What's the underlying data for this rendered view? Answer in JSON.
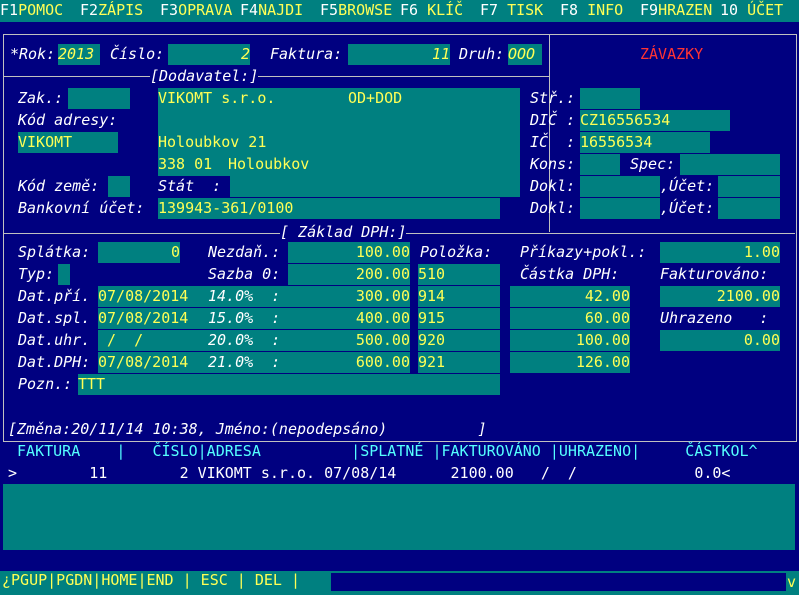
{
  "fkeys": [
    {
      "key": "F1",
      "label": "POMOC"
    },
    {
      "key": "F2",
      "label": "ZÁPIS"
    },
    {
      "key": "F3",
      "label": "OPRAVA"
    },
    {
      "key": "F4",
      "label": "NAJDI"
    },
    {
      "key": "F5",
      "label": "BROWSE"
    },
    {
      "key": "F6",
      "label": " KLÍČ"
    },
    {
      "key": "F7",
      "label": " TISK"
    },
    {
      "key": "F8",
      "label": " INFO"
    },
    {
      "key": "F9",
      "label": "HRAZEN"
    },
    {
      "key": "10",
      "label": " ÚČET"
    }
  ],
  "header": {
    "rok_label": "*Rok:",
    "rok": "2013",
    "cislo_label": "Číslo:",
    "cislo": "2",
    "faktura_label": "Faktura:",
    "faktura": "11",
    "druh_label": "Druh:",
    "druh": "OOO",
    "doc_type": "ZÁVAZKY"
  },
  "dodavatel": {
    "title": "[Dodavatel:]",
    "zak_label": "Zak.:",
    "zak": "",
    "name": "VIKOMT s.r.o.",
    "name_suffix": "OD+DOD",
    "kod_adresy_label": "Kód adresy:",
    "kod_adresy": "VIKOMT",
    "street": "Holoubkov 21",
    "psc": "338 01",
    "city": "Holoubkov",
    "kod_zeme_label": "Kód země:",
    "stat_label": "Stát  :",
    "bank_label": "Bankovní účet:",
    "bank": "139943-361/0100"
  },
  "side": {
    "str_label": "Stř.:",
    "dic_label": "DIČ :",
    "dic": "CZ16556534",
    "ic_label": "IČ  :",
    "ic": "16556534",
    "kons_label": "Kons:",
    "spec_label": "Spec:",
    "dokl_label": "Dokl:",
    "ucet_label": ",Účet:"
  },
  "dph": {
    "title": "[ Základ DPH:]",
    "splatka_label": "Splátka:",
    "splatka": "0",
    "typ_label": "Typ:",
    "dat_pri_label": "Dat.pří.",
    "dat_pri": "07/08/2014",
    "dat_spl_label": "Dat.spl.",
    "dat_spl": "07/08/2014",
    "dat_uhr_label": "Dat.uhr.",
    "dat_uhr": " /  /",
    "dat_dph_label": "Dat.DPH:",
    "dat_dph": "07/08/2014",
    "pozn_label": "Pozn.:",
    "pozn": "TTT",
    "nezdan_label": "Nezdaň.:",
    "sazba0_label": "Sazba 0:",
    "rate_rows": [
      {
        "label": "14.0%  :"
      },
      {
        "label": "15.0%  :"
      },
      {
        "label": "20.0%  :"
      },
      {
        "label": "21.0%  :"
      }
    ],
    "amounts": [
      "100.00",
      "200.00",
      "300.00",
      "400.00",
      "500.00",
      "600.00"
    ],
    "polozka_label": "Položka:",
    "polozky": [
      "",
      "510",
      "914",
      "915",
      "920",
      "921"
    ],
    "prikazy_label": "Příkazy+pokl.:",
    "prikazy": "1.00",
    "castka_label": "Částka DPH:",
    "castky": [
      "42.00",
      "60.00",
      "100.00",
      "126.00"
    ],
    "fakturovano_label": "Fakturováno:",
    "fakturovano": "2100.00",
    "uhrazeno_label": "Uhrazeno   :",
    "uhrazeno": "0.00"
  },
  "footer": {
    "change_line": "[Změna:20/11/14 10:38, Jméno:(nepodepsáno)          ]"
  },
  "table": {
    "header": " FAKTURA    |   ČÍSLO|ADRESA          |SPLATNÉ |FAKTUROVÁNO |UHRAZENO|     ČÁSTKOL^",
    "row": ">        11        2 VIKOMT s.r.o. 07/08/14      2100.00   /  /             0.0<"
  },
  "bottom": {
    "keys": "¿PGUP|PGDN|HOME|END | ESC | DEL |",
    "right_mark": "v"
  },
  "colors": {
    "background": "#000080",
    "field": "#008080",
    "value": "#ffff55",
    "label": "#ffffff",
    "title": "#ff3333",
    "list_text": "#55ffff"
  }
}
